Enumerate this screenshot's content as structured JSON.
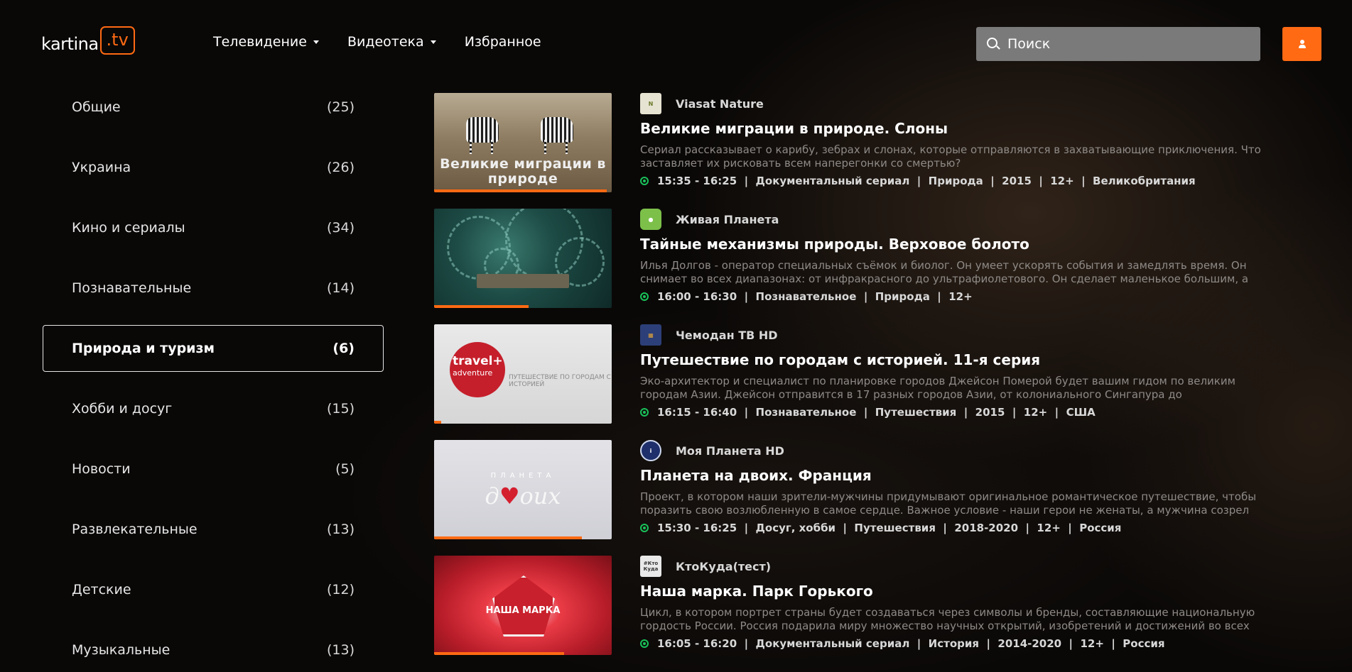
{
  "header": {
    "logo_main": "kartina",
    "logo_tv": ".tv",
    "nav": [
      {
        "label": "Телевидение"
      },
      {
        "label": "Видеотека"
      },
      {
        "label": "Избранное"
      }
    ],
    "search_placeholder": "Поиск"
  },
  "colors": {
    "accent": "#ff6a13",
    "live": "#19c25a"
  },
  "sidebar": {
    "categories": [
      {
        "label": "Общие",
        "count": "(25)"
      },
      {
        "label": "Украина",
        "count": "(26)"
      },
      {
        "label": "Кино и сериалы",
        "count": "(34)"
      },
      {
        "label": "Познавательные",
        "count": "(14)"
      },
      {
        "label": "Природа и туризм",
        "count": "(6)",
        "active": true
      },
      {
        "label": "Хобби и досуг",
        "count": "(15)"
      },
      {
        "label": "Новости",
        "count": "(5)"
      },
      {
        "label": "Развлекательные",
        "count": "(13)"
      },
      {
        "label": "Детские",
        "count": "(12)"
      },
      {
        "label": "Музыкальные",
        "count": "(13)"
      }
    ]
  },
  "programs": [
    {
      "channel": "Viasat Nature",
      "title": "Великие миграции в природе. Слоны",
      "description": "Сериал рассказывает о карибу, зебрах и слонах, которые отправляются в захватывающие приключения. Что заставляет их рисковать всем наперегонки со смертью?",
      "meta": "15:35 - 16:25  |  Документальный сериал  |  Природа  |  2015  |  12+  |  Великобритания",
      "thumb_caption": "Великие миграции в природе",
      "progress": 0.97
    },
    {
      "channel": "Живая Планета",
      "title": "Тайные механизмы природы. Верховое болото",
      "description": "Илья Долгов - оператор специальных съёмок и биолог. Он умеет ускорять события и замедлять время. Он снимает во всех диапазонах: от инфракрасного до ультрафиолетового. Он сделает маленькое большим, а",
      "meta": "16:00 - 16:30  |  Познавательное  |  Природа  |  12+",
      "progress": 0.53
    },
    {
      "channel": "Чемодан ТВ HD",
      "title": "Путешествие по городам с историей. 11-я серия",
      "description": "Эко-архитектор и специалист по планировке городов Джейсон Померой будет вашим гидом по великим городам Азии. Джейсон отправится в 17 разных городов Азии, от колониального Сингапура до романтического",
      "meta": "16:15 - 16:40  |  Познавательное  |  Путешествия  |  2015  |  12+  |  США",
      "thumb_brand": "travel+",
      "thumb_brand_sub": "adventure",
      "thumb_sub": "ПУТЕШЕСТВИЕ ПО ГОРОДАМ С ИСТОРИЕЙ",
      "progress": 0.04
    },
    {
      "channel": "Моя Планета HD",
      "title": "Планета на двоих. Франция",
      "description": "Проект, в котором наши зрители-мужчины придумывают оригинальное романтическое путешествие, чтобы поразить свою возлюбленную в самое сердце. Важное условие - наши герои не женаты, а мужчина созрел",
      "meta": "15:30 - 16:25  |  Досуг, хобби  |  Путешествия  |  2018-2020  |  12+  |  Россия",
      "thumb_top": "ПЛАНЕТА",
      "thumb_main_a": "д",
      "thumb_main_heart": "♥",
      "thumb_main_b": "оих",
      "progress": 0.83
    },
    {
      "channel": "КтоКуда(тест)",
      "title": "Наша марка. Парк Горького",
      "description": "Цикл, в котором портрет страны будет создаваться через символы и бренды, составляющие национальную гордость России. Россия подарила миру множество научных открытий, изобретений и достижений во всех",
      "meta": "16:05 - 16:20  |  Документальный сериал  |  История  |  2014-2020  |  12+  |  Россия",
      "thumb_badge": "НАША МАРКА",
      "progress": 0.73
    }
  ]
}
